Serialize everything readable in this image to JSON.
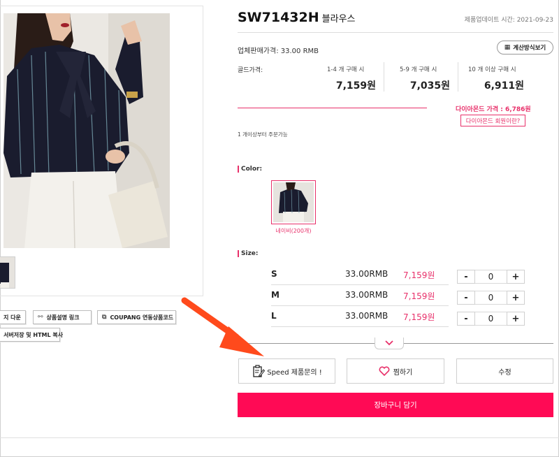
{
  "product": {
    "code": "SW71432H",
    "category": "블라우스",
    "update_label": "제품업데이트 시간:",
    "update_date": "2021-09-23"
  },
  "pricing": {
    "wholesale_label": "업체판매가격:",
    "wholesale_value": "33.00 RMB",
    "calc_button": "계산방식보기",
    "gold_label": "골드가격:",
    "tiers": [
      {
        "caption": "1-4 개 구매 시",
        "price": "7,159원"
      },
      {
        "caption": "5-9 개 구매 시",
        "price": "7,035원"
      },
      {
        "caption": "10 개 이상 구매 시",
        "price": "6,911원"
      }
    ],
    "diamond_label": "다이아몬드 가격 :",
    "diamond_value": "6,786원",
    "diamond_info_button": "다이아몬드 회원이란?",
    "min_order": "1 개이상부터 주문가능"
  },
  "options": {
    "color_label": "Color:",
    "colors": [
      {
        "name": "네이비(200개)"
      }
    ],
    "size_label": "Size:",
    "sizes": [
      {
        "name": "S",
        "rmb": "33.00RMB",
        "won": "7,159원",
        "qty": "0"
      },
      {
        "name": "M",
        "rmb": "33.00RMB",
        "won": "7,159원",
        "qty": "0"
      },
      {
        "name": "L",
        "rmb": "33.00RMB",
        "won": "7,159원",
        "qty": "0"
      }
    ],
    "minus": "-",
    "plus": "+"
  },
  "tools": {
    "download_label": "지 다운",
    "link_label": "상품설명 링크",
    "coupang_label": "COUPANG 연동상품코드",
    "html_copy_label": "서버저장 및 HTML 복사"
  },
  "actions": {
    "inquiry": "Speed 제품문의 !",
    "wishlist": "찜하기",
    "edit": "수정",
    "cart": "장바구니 담기"
  },
  "colors": {
    "accent": "#e8306a",
    "cart": "#ff0a55",
    "annotation_arrow": "#ff4a1c"
  }
}
